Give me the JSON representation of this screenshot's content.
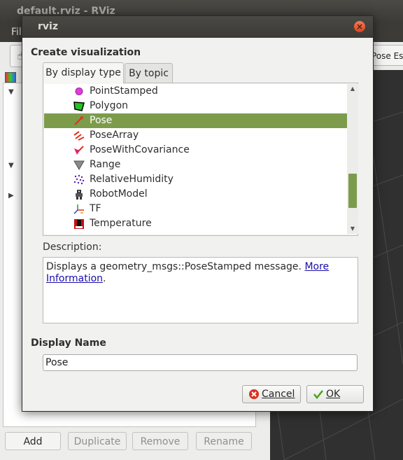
{
  "main_window": {
    "title": "default.rviz - RViz",
    "menu_first": "Fil",
    "toolbar_pose_button": "Pose Esti",
    "buttons": [
      "Add",
      "Duplicate",
      "Remove",
      "Rename"
    ]
  },
  "dialog": {
    "title": "rviz",
    "heading": "Create visualization",
    "tabs": [
      "By display type",
      "By topic"
    ],
    "selected_tab": "By display type",
    "display_types": [
      {
        "label": "PointStamped",
        "icon": "point-stamped-icon"
      },
      {
        "label": "Polygon",
        "icon": "polygon-icon"
      },
      {
        "label": "Pose",
        "icon": "pose-icon"
      },
      {
        "label": "PoseArray",
        "icon": "pose-array-icon"
      },
      {
        "label": "PoseWithCovariance",
        "icon": "pose-with-covariance-icon"
      },
      {
        "label": "Range",
        "icon": "range-icon"
      },
      {
        "label": "RelativeHumidity",
        "icon": "relative-humidity-icon"
      },
      {
        "label": "RobotModel",
        "icon": "robot-model-icon"
      },
      {
        "label": "TF",
        "icon": "tf-icon"
      },
      {
        "label": "Temperature",
        "icon": "temperature-icon"
      }
    ],
    "selected_display": "Pose",
    "description_label": "Description:",
    "description_text": "Displays a geometry_msgs::PoseStamped message.",
    "description_link": "More Information",
    "description_end": ".",
    "display_name_heading": "Display Name",
    "display_name_value": "Pose",
    "cancel_label": "Cancel",
    "ok_label": "OK"
  },
  "colors": {
    "selection": "#7c9c4c",
    "title_bar": "#3c3b37",
    "close_button": "#e05a30",
    "link": "#1a0dab"
  }
}
